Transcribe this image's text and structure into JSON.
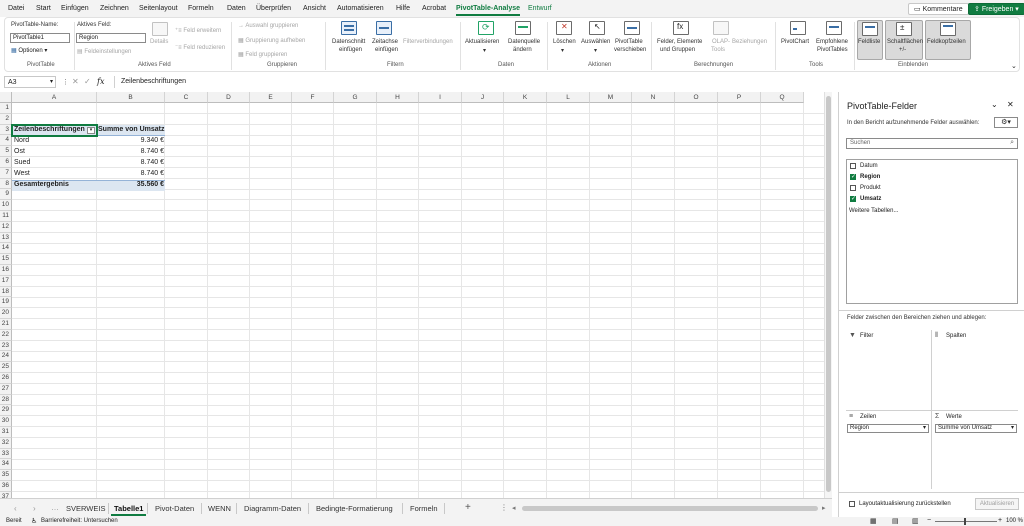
{
  "menu": {
    "tabs": [
      "Datei",
      "Start",
      "Einfügen",
      "Zeichnen",
      "Seitenlayout",
      "Formeln",
      "Daten",
      "Überprüfen",
      "Ansicht",
      "Automatisieren",
      "Hilfe",
      "Acrobat",
      "PivotTable-Analyse",
      "Entwurf"
    ],
    "comments": "Kommentare",
    "share": "Freigeben"
  },
  "ribbon": {
    "pivottable_name_label": "PivotTable-Name:",
    "pivottable_name_value": "PivotTable1",
    "options": "Optionen",
    "group_pivottable": "PivotTable",
    "active_field_label": "Aktives Feld:",
    "active_field_value": "Region",
    "field_settings": "Feldeinstellungen",
    "details": "Details",
    "expand_field": "Feld erweitern",
    "collapse_field": "Feld reduzieren",
    "group_active_field": "Aktives Feld",
    "group_selection": "Auswahl gruppieren",
    "ungroup": "Gruppierung aufheben",
    "group_field": "Feld gruppieren",
    "group_grouping": "Gruppieren",
    "slicer": [
      "Datenschnitt",
      "einfügen"
    ],
    "timeline": [
      "Zeitachse",
      "einfügen"
    ],
    "filter_connections": "Filterverbindungen",
    "group_filter": "Filtern",
    "refresh": "Aktualisieren",
    "change_source": [
      "Datenquelle",
      "ändern"
    ],
    "group_data": "Daten",
    "clear": "Löschen",
    "select": "Auswählen",
    "move_pivot": [
      "PivotTable",
      "verschieben"
    ],
    "group_actions": "Aktionen",
    "fields_items": [
      "Felder, Elemente",
      "und Gruppen"
    ],
    "olap": [
      "OLAP-",
      "Tools"
    ],
    "relationships": "Beziehungen",
    "group_calculations": "Berechnungen",
    "pivotchart": "PivotChart",
    "recommended": [
      "Empfohlene",
      "PivotTables"
    ],
    "group_tools": "Tools",
    "field_list": "Feldliste",
    "buttons": [
      "Schaltflächen",
      "+/-"
    ],
    "field_headers": "Feldkopfzeilen",
    "group_show": "Einblenden"
  },
  "formula": {
    "namebox": "A3",
    "fx": "fx",
    "content": "Zeilenbeschriftungen"
  },
  "grid": {
    "columns": [
      "A",
      "B",
      "C",
      "D",
      "E",
      "F",
      "G",
      "H",
      "I",
      "J",
      "K",
      "L",
      "M",
      "N",
      "O",
      "P",
      "Q"
    ],
    "row_count": 37,
    "pivot": {
      "header_row_label": "Zeilenbeschriftungen",
      "header_value_label": "Summe von Umsatz",
      "rows": [
        {
          "label": "Nord",
          "value": "9.340 €"
        },
        {
          "label": "Ost",
          "value": "8.740 €"
        },
        {
          "label": "Sued",
          "value": "8.740 €"
        },
        {
          "label": "West",
          "value": "8.740 €"
        }
      ],
      "total_label": "Gesamtergebnis",
      "total_value": "35.560 €"
    }
  },
  "pane": {
    "title": "PivotTable-Felder",
    "subtitle": "In den Bericht aufzunehmende Felder auswählen:",
    "search_placeholder": "Suchen",
    "fields": [
      {
        "name": "Datum",
        "checked": false
      },
      {
        "name": "Region",
        "checked": true
      },
      {
        "name": "Produkt",
        "checked": false
      },
      {
        "name": "Umsatz",
        "checked": true
      }
    ],
    "more_tables": "Weitere Tabellen...",
    "drag_hint": "Felder zwischen den Bereichen ziehen und ablegen:",
    "area_filter": "Filter",
    "area_columns": "Spalten",
    "area_rows": "Zeilen",
    "area_values": "Werte",
    "rows_item": "Region",
    "values_item": "Summe von Umsatz",
    "defer_update": "Layoutaktualisierung zurückstellen",
    "update_button": "Aktualisieren"
  },
  "sheets": {
    "tabs": [
      "SVERWEIS",
      "Tabelle1",
      "Pivot-Daten",
      "WENN",
      "Diagramm-Daten",
      "Bedingte-Formatierung",
      "Formeln"
    ],
    "active": "Tabelle1"
  },
  "status": {
    "ready": "Bereit",
    "accessibility": "Barrierefreiheit: Untersuchen",
    "zoom": "100 %"
  },
  "colors": {
    "accent": "#107c41",
    "pivot_header": "#dce6f1"
  }
}
